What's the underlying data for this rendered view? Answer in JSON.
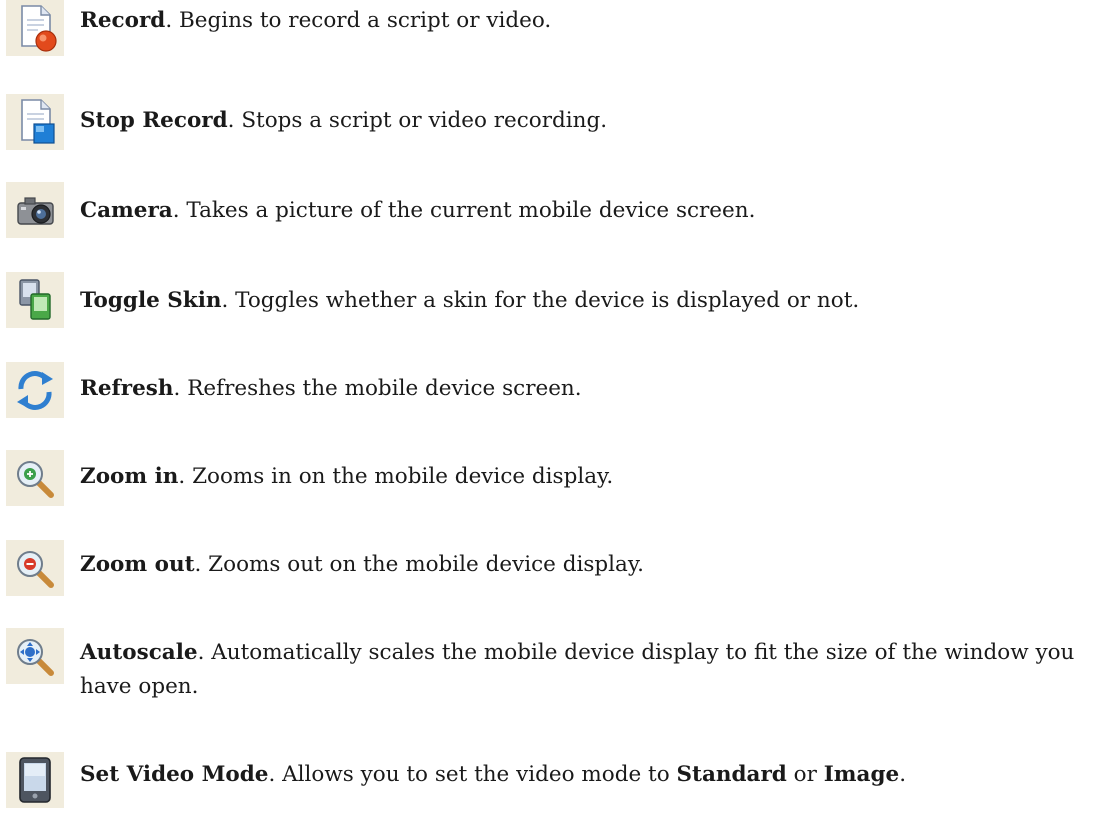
{
  "entries": [
    {
      "icon": "record-icon",
      "term": "Record",
      "desc": ". Begins to record a script or video."
    },
    {
      "icon": "stop-record-icon",
      "term": "Stop Record",
      "desc": ". Stops a script or video recording."
    },
    {
      "icon": "camera-icon",
      "term": "Camera",
      "desc": ". Takes a picture of the current mobile device screen."
    },
    {
      "icon": "toggle-skin-icon",
      "term": "Toggle Skin",
      "desc": ". Toggles whether a skin for the device is displayed or not."
    },
    {
      "icon": "refresh-icon",
      "term": "Refresh",
      "desc": ". Refreshes the mobile device screen."
    },
    {
      "icon": "zoom-in-icon",
      "term": "Zoom in",
      "desc": ". Zooms in on the mobile device display."
    },
    {
      "icon": "zoom-out-icon",
      "term": "Zoom out",
      "desc": ". Zooms out on the mobile device display."
    },
    {
      "icon": "autoscale-icon",
      "term": "Autoscale",
      "desc": ". Automatically scales the mobile device display to fit the size of the window you have open."
    },
    {
      "icon": "set-video-mode-icon",
      "term": "Set Video Mode",
      "desc": ". Allows you to set the video mode to ",
      "opt1": "Standard",
      "mid": " or ",
      "opt2": "Image",
      "end": "."
    }
  ]
}
